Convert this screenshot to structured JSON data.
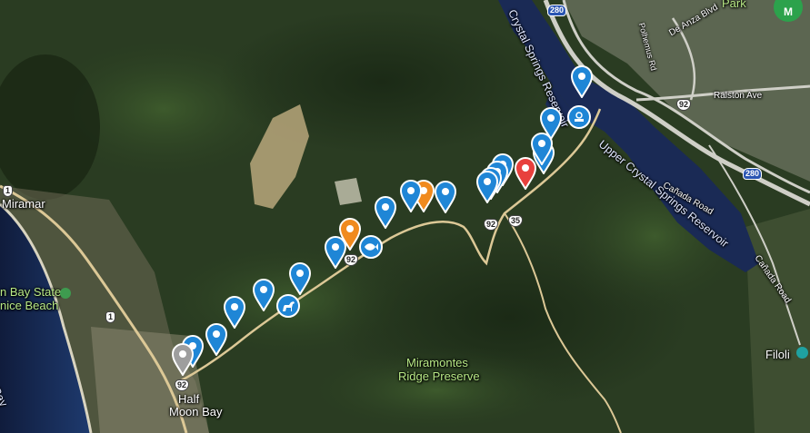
{
  "map": {
    "colors": {
      "water": "#1c2e5a",
      "road": "#d8c28c",
      "pin_blue": "#1f86d6",
      "pin_orange": "#f08a1e",
      "pin_red": "#e8403d",
      "pin_gray": "#9e9e9e"
    },
    "labels": {
      "miramar": "Miramar",
      "half_moon_1": "Half",
      "half_moon_2": "Moon Bay",
      "beach_1": "n Bay State",
      "beach_2": "nice Beach",
      "moon_bay": "Moon Bay",
      "miramontes_1": "Miramontes",
      "miramontes_2": "Ridge Preserve",
      "upper_crystal": "Upper Crystal Springs Reservoir",
      "crystal_springs": "Crystal Springs Reservoir",
      "ralston": "Ralston Ave",
      "de_anza": "De Anza Blvd",
      "canada_road_1": "Cañada Road",
      "canada_road_2": "Cañada Road",
      "park": "Park",
      "filoli": "Filoli",
      "polhemus": "Polhemus Rd"
    },
    "shields": {
      "hwy92_a": "92",
      "hwy92_b": "92",
      "hwy92_c": "92",
      "hwy92_d": "92",
      "hwy35": "35",
      "hwy1_a": "1",
      "hwy1_b": "1",
      "i280_a": "280",
      "i280_b": "280"
    },
    "avatar_letter": "M"
  }
}
